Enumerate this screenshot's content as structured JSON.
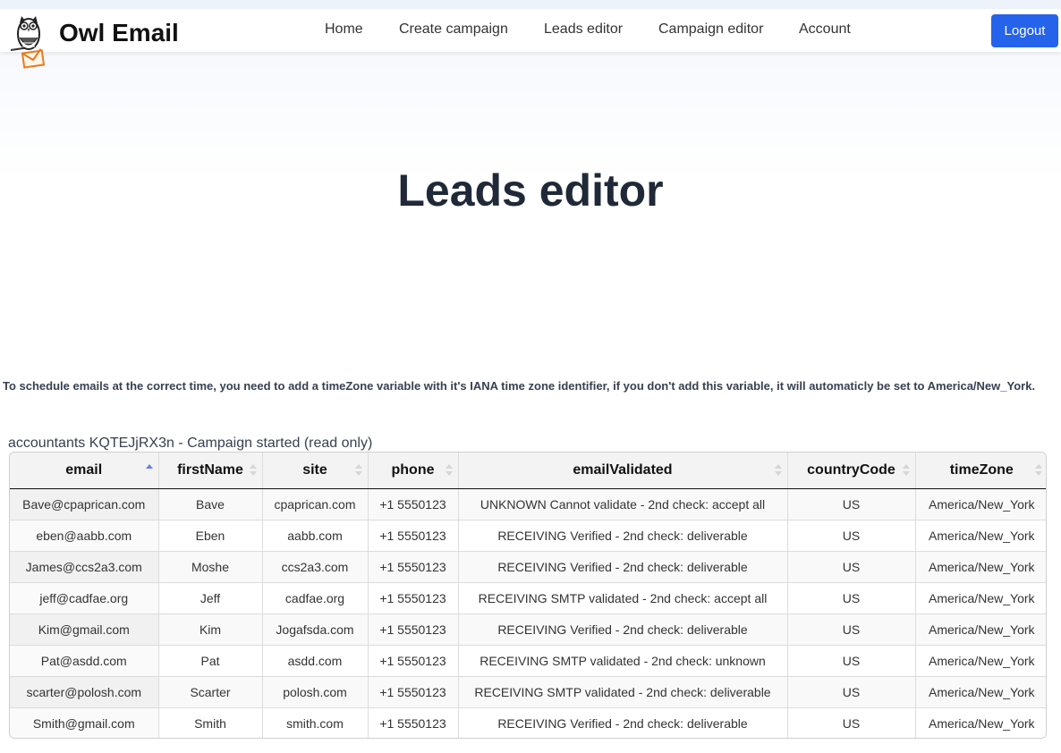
{
  "brand": {
    "name": "Owl Email",
    "logo_icon": "owl-envelope-icon"
  },
  "nav": {
    "links": [
      "Home",
      "Create campaign",
      "Leads editor",
      "Campaign editor",
      "Account"
    ],
    "logout_label": "Logout"
  },
  "page": {
    "title": "Leads editor",
    "info_text": "To schedule emails at the correct time, you need to add a timeZone variable with it's IANA time zone identifier, if you don't add this variable, it will automaticly be set to America/New_York."
  },
  "table": {
    "caption": "accountants KQTEJjRX3n - Campaign started (read only)",
    "sorted_column": "email",
    "sort_direction": "ascending",
    "headers": [
      "email",
      "firstName",
      "site",
      "phone",
      "emailValidated",
      "countryCode",
      "timeZone"
    ],
    "rows": [
      [
        "Bave@cpaprican.com",
        "Bave",
        "cpaprican.com",
        "+1 5550123",
        "UNKNOWN Cannot validate - 2nd check: accept all",
        "US",
        "America/New_York"
      ],
      [
        "eben@aabb.com",
        "Eben",
        "aabb.com",
        "+1 5550123",
        "RECEIVING Verified - 2nd check: deliverable",
        "US",
        "America/New_York"
      ],
      [
        "James@ccs2a3.com",
        "Moshe",
        "ccs2a3.com",
        "+1 5550123",
        "RECEIVING Verified - 2nd check: deliverable",
        "US",
        "America/New_York"
      ],
      [
        "jeff@cadfae.org",
        "Jeff",
        "cadfae.org",
        "+1 5550123",
        "RECEIVING SMTP validated - 2nd check: accept all",
        "US",
        "America/New_York"
      ],
      [
        "Kim@gmail.com",
        "Kim",
        "Jogafsda.com",
        "+1 5550123",
        "RECEIVING Verified - 2nd check: deliverable",
        "US",
        "America/New_York"
      ],
      [
        "Pat@asdd.com",
        "Pat",
        "asdd.com",
        "+1 5550123",
        "RECEIVING SMTP validated - 2nd check: unknown",
        "US",
        "America/New_York"
      ],
      [
        "scarter@polosh.com",
        "Scarter",
        "polosh.com",
        "+1 5550123",
        "RECEIVING SMTP validated - 2nd check: deliverable",
        "US",
        "America/New_York"
      ],
      [
        "Smith@gmail.com",
        "Smith",
        "smith.com",
        "+1 5550123",
        "RECEIVING Verified - 2nd check: deliverable",
        "US",
        "America/New_York"
      ]
    ]
  },
  "colors": {
    "accent": "#2563eb",
    "sort_active": "#6b7ee8",
    "title": "#1f2937"
  }
}
